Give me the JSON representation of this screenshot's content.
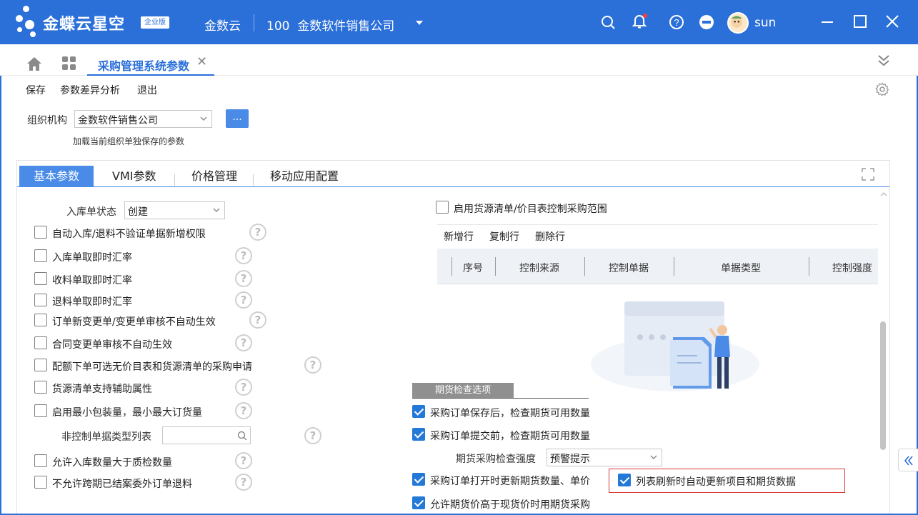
{
  "app": {
    "brand": "金蝶云星空",
    "edition_badge": "企业版",
    "cloud_label": "金数云",
    "org_code": "100",
    "org_name": "金数软件销售公司",
    "user": "sun",
    "accent_color": "#2b6fd9"
  },
  "tabs": {
    "active_page": "采购管理系统参数"
  },
  "toolbar": {
    "save": "保存",
    "param_diff": "参数差异分析",
    "exit": "退出"
  },
  "org_selector": {
    "label": "组织机构",
    "value": "金数软件销售公司",
    "more_button": "...",
    "hint": "加载当前组织单独保存的参数"
  },
  "panel_tabs": [
    {
      "label": "基本参数",
      "active": true
    },
    {
      "label": "VMI参数",
      "active": false
    },
    {
      "label": "价格管理",
      "active": false
    },
    {
      "label": "移动应用配置",
      "active": false
    }
  ],
  "left": {
    "stock_status_label": "入库单状态",
    "stock_status_value": "创建",
    "options": [
      {
        "label": "自动入库/退料不验证单据新增权限",
        "checked": false
      },
      {
        "label": "入库单取即时汇率",
        "checked": false
      },
      {
        "label": "收料单取即时汇率",
        "checked": false
      },
      {
        "label": "退料单取即时汇率",
        "checked": false
      },
      {
        "label": "订单新变更单/变更单审核不自动生效",
        "checked": false
      },
      {
        "label": "合同变更单审核不自动生效",
        "checked": false
      },
      {
        "label": "配额下单可选无价目表和货源清单的采购申请",
        "checked": false
      },
      {
        "label": "货源清单支持辅助属性",
        "checked": false
      },
      {
        "label": "启用最小包装量，最小最大订货量",
        "checked": false
      }
    ],
    "non_control_label": "非控制单据类型列表",
    "non_control_value": "",
    "options2": [
      {
        "label": "允许入库数量大于质检数量",
        "checked": false
      },
      {
        "label": "不允许跨期已结案委外订单退料",
        "checked": false
      }
    ]
  },
  "right": {
    "source_control": {
      "label": "启用货源清单/价目表控制采购范围",
      "checked": false
    },
    "grid_actions": {
      "add": "新增行",
      "copy": "复制行",
      "delete": "删除行"
    },
    "grid_columns": [
      "序号",
      "控制来源",
      "控制单据",
      "单据类型",
      "控制强度"
    ],
    "futures_section": "期货检查选项",
    "futures": [
      {
        "label": "采购订单保存后，检查期货可用数量",
        "checked": true
      },
      {
        "label": "采购订单提交前，检查期货可用数量",
        "checked": true
      }
    ],
    "futures_strength_label": "期货采购检查强度",
    "futures_strength_value": "预警提示",
    "refresh_on_open": {
      "label": "采购订单打开时更新期货数量、单价",
      "checked": true
    },
    "list_refresh": {
      "label": "列表刷新时自动更新项目和期货数据",
      "checked": true
    },
    "allow_higher": {
      "label": "允许期货价高于现货价时用期货采购",
      "checked": true
    }
  },
  "icons": {
    "search": "search-icon",
    "bell": "bell-icon",
    "help": "help-icon",
    "minus": "minus-circle-icon",
    "minimize": "minimize-icon",
    "maximize": "maximize-icon",
    "close": "close-icon",
    "home": "home-icon",
    "apps": "apps-grid-icon",
    "collapse": "double-chevron-down-icon",
    "settings": "gear-icon",
    "expand": "expand-icon",
    "side_toggle": "double-chevron-left-icon"
  }
}
